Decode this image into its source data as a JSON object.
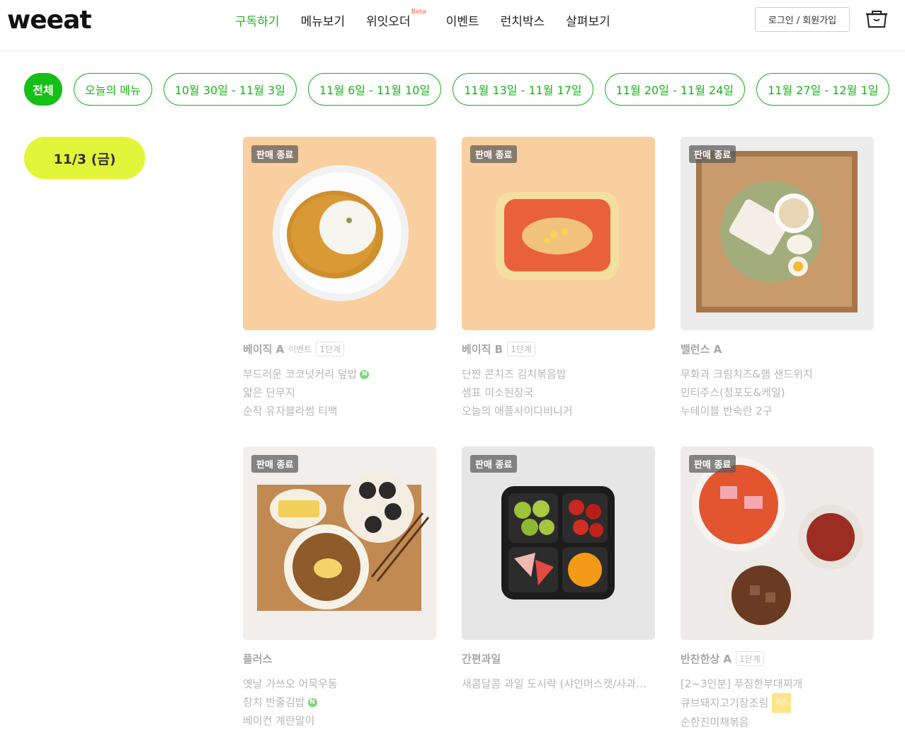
{
  "header": {
    "logo": "weeat",
    "nav": [
      {
        "label": "구독하기",
        "active": true
      },
      {
        "label": "메뉴보기"
      },
      {
        "label": "위잇오더",
        "badge": "Beta"
      },
      {
        "label": "이벤트"
      },
      {
        "label": "런치박스"
      },
      {
        "label": "살펴보기"
      }
    ],
    "login_label": "로그인 / 회원가입",
    "cart_icon": "lunchbox-cart-icon"
  },
  "filters": [
    "전체",
    "오늘의 메뉴",
    "10월 30일 - 11월 3일",
    "11월 6일 - 11월 10일",
    "11월 13일 - 11월 17일",
    "11월 20일 - 11월 24일",
    "11월 27일 - 12월 1일"
  ],
  "date_pill": "11/3 (금)",
  "badge_text": "판매 종료",
  "colors": {
    "accent": "#15bf15",
    "date_pill": "#e3f53b"
  },
  "cards": [
    {
      "category": "베이직 A",
      "tags": [
        "이벤트",
        "1단계"
      ],
      "items": [
        "부드러운 코코넛커리 덮밥",
        "얇은 단무지",
        "순작 유자블라썸 티백"
      ],
      "item_marks": [
        "N",
        "",
        ""
      ]
    },
    {
      "category": "베이직 B",
      "tags": [
        "1단계"
      ],
      "items": [
        "단짠 콘치즈 김치볶음밥",
        "샘표 미소된장국",
        "오늘의 애플사이다비니거"
      ],
      "item_marks": [
        "",
        "",
        ""
      ]
    },
    {
      "category": "밸런스 A",
      "tags": [],
      "items": [
        "무화과 크림치즈&햄 샌드위치",
        "민티주스(청포도&케일)",
        "누테이블 반숙란 2구"
      ],
      "item_marks": [
        "",
        "",
        ""
      ]
    },
    {
      "category": "플러스",
      "tags": [],
      "items": [
        "옛날 가쓰오 어묵우동",
        "참치 반줄김밥",
        "베이컨 계란말이"
      ],
      "item_marks": [
        "",
        "N",
        ""
      ]
    },
    {
      "category": "간편과일",
      "tags": [],
      "items": [
        "새콤달콤 과일 도시락 (샤인머스캣/사과…"
      ],
      "item_marks": [
        ""
      ]
    },
    {
      "category": "반찬한상 A",
      "tags": [
        "1단계"
      ],
      "items": [
        "[2~3인분] 푸짐한부대찌개",
        "큐브돼지고기장조림",
        "순한진미채볶음"
      ],
      "item_marks": [
        "",
        "키즈",
        ""
      ]
    }
  ]
}
